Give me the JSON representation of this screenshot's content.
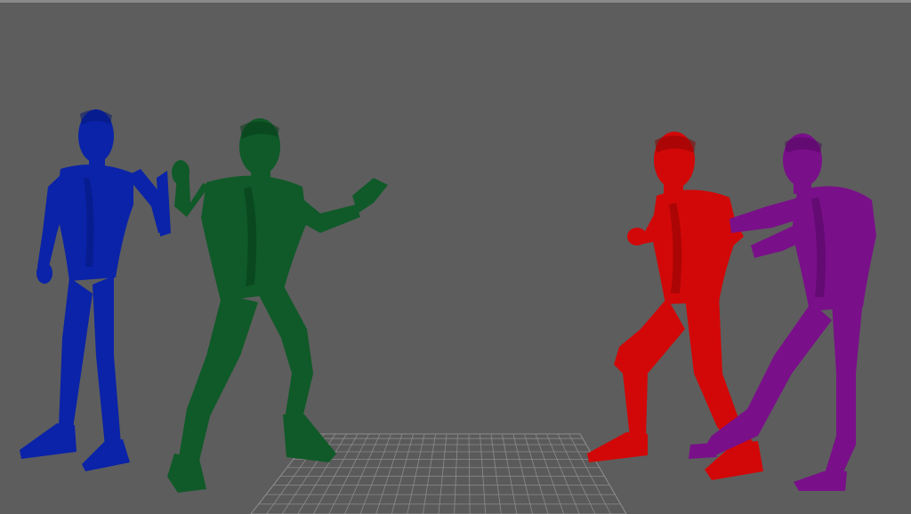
{
  "viewport": {
    "background_color": "#5d5d5d",
    "border_color": "#8a8a8a",
    "grid_color": "#8c8c8c",
    "grid_fill": "#5a5a5a"
  },
  "figures": [
    {
      "name": "blue-figure",
      "color": "#0a23a8",
      "shade": "#061878"
    },
    {
      "name": "green-figure",
      "color": "#0f5a28",
      "shade": "#083d1a"
    },
    {
      "name": "red-figure",
      "color": "#d20808",
      "shade": "#8c0404"
    },
    {
      "name": "purple-figure",
      "color": "#7a0f8a",
      "shade": "#500860"
    }
  ]
}
